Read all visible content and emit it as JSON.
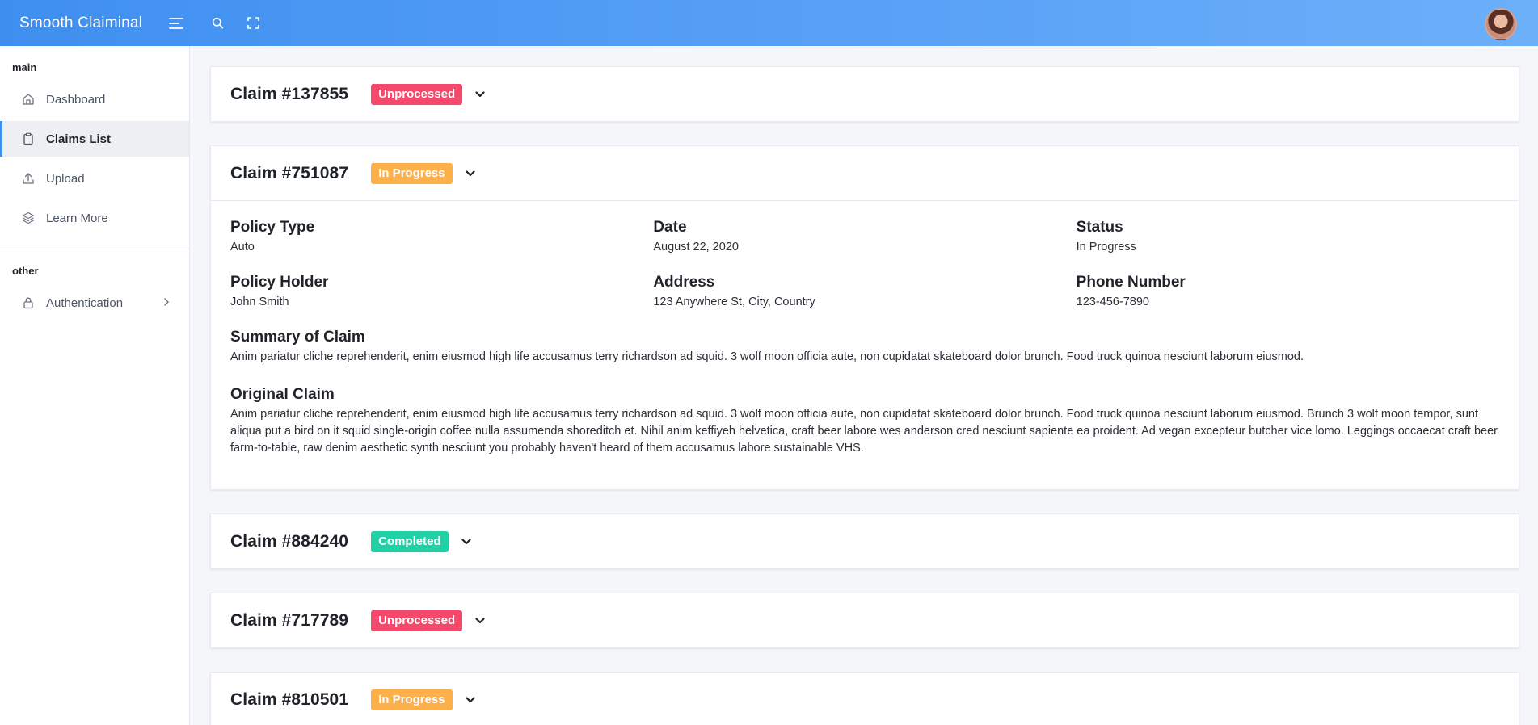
{
  "app": {
    "title": "Smooth Claiminal"
  },
  "topbar": {
    "menu_icon": "menu-icon",
    "search_icon": "search-icon",
    "fullscreen_icon": "fullscreen-icon"
  },
  "sidebar": {
    "sections": [
      {
        "label": "main",
        "items": [
          {
            "label": "Dashboard",
            "icon": "home-icon"
          },
          {
            "label": "Claims List",
            "icon": "clipboard-icon",
            "active": true
          },
          {
            "label": "Upload",
            "icon": "upload-icon"
          },
          {
            "label": "Learn More",
            "icon": "layers-icon"
          }
        ]
      },
      {
        "label": "other",
        "items": [
          {
            "label": "Authentication",
            "icon": "lock-icon"
          }
        ]
      }
    ]
  },
  "claims": [
    {
      "title": "Claim #137855",
      "status": "Unprocessed"
    },
    {
      "title": "Claim #751087",
      "status": "In Progress",
      "details": {
        "policy_type_label": "Policy Type",
        "policy_type": "Auto",
        "date_label": "Date",
        "date": "August 22, 2020",
        "status_label": "Status",
        "status": "In Progress",
        "policy_holder_label": "Policy Holder",
        "policy_holder": "John Smith",
        "address_label": "Address",
        "address": "123 Anywhere St, City, Country",
        "phone_label": "Phone Number",
        "phone": "123-456-7890",
        "summary_label": "Summary of Claim",
        "summary": "Anim pariatur cliche reprehenderit, enim eiusmod high life accusamus terry richardson ad squid. 3 wolf moon officia aute, non cupidatat skateboard dolor brunch. Food truck quinoa nesciunt laborum eiusmod.",
        "original_label": "Original Claim",
        "original": "Anim pariatur cliche reprehenderit, enim eiusmod high life accusamus terry richardson ad squid. 3 wolf moon officia aute, non cupidatat skateboard dolor brunch. Food truck quinoa nesciunt laborum eiusmod. Brunch 3 wolf moon tempor, sunt aliqua put a bird on it squid single-origin coffee nulla assumenda shoreditch et. Nihil anim keffiyeh helvetica, craft beer labore wes anderson cred nesciunt sapiente ea proident. Ad vegan excepteur butcher vice lomo. Leggings occaecat craft beer farm-to-table, raw denim aesthetic synth nesciunt you probably haven't heard of them accusamus labore sustainable VHS."
      }
    },
    {
      "title": "Claim #884240",
      "status": "Completed"
    },
    {
      "title": "Claim #717789",
      "status": "Unprocessed"
    },
    {
      "title": "Claim #810501",
      "status": "In Progress"
    }
  ],
  "colors": {
    "unprocessed": "#f5486b",
    "in_progress": "#fdb049",
    "completed": "#1fd1a5",
    "accent": "#3f8ff0"
  }
}
